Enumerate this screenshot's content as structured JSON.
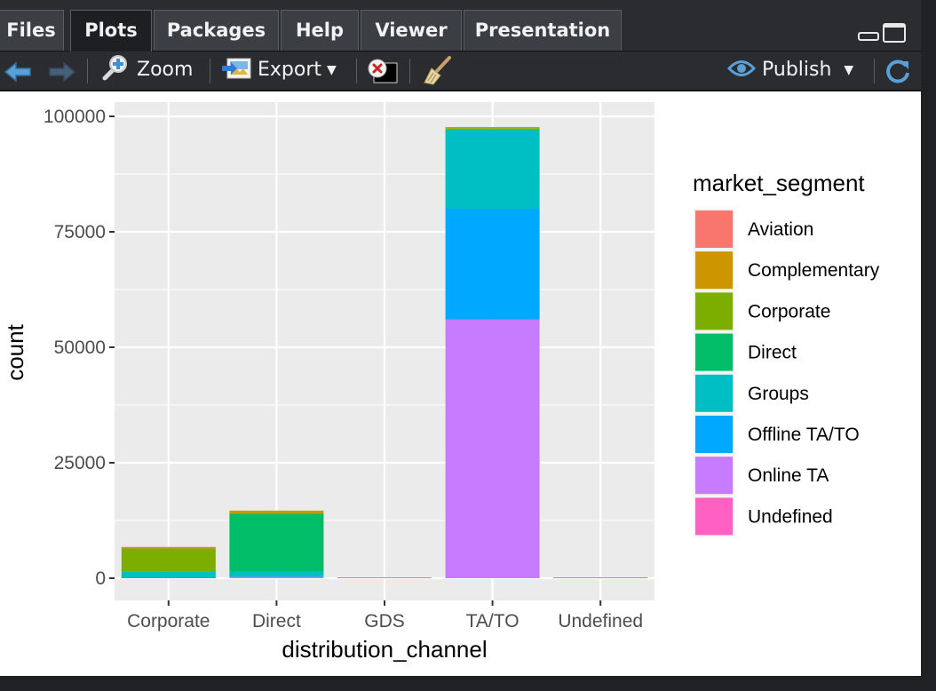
{
  "tabs": {
    "files": "Files",
    "plots": "Plots",
    "packages": "Packages",
    "help": "Help",
    "viewer": "Viewer",
    "presentation": "Presentation"
  },
  "toolbar": {
    "zoom_label": "Zoom",
    "export_label": "Export",
    "publish_label": "Publish"
  },
  "colors": {
    "panel_bg": "#ebebeb",
    "grid": "#ffffff"
  },
  "chart_data": {
    "type": "bar",
    "stacked": true,
    "xlabel": "distribution_channel",
    "ylabel": "count",
    "ylim": [
      0,
      103000
    ],
    "y_ticks": [
      0,
      25000,
      50000,
      75000,
      100000
    ],
    "y_tick_labels": [
      "0",
      "25000",
      "50000",
      "75000",
      "100000"
    ],
    "categories": [
      "Corporate",
      "Direct",
      "GDS",
      "TA/TO",
      "Undefined"
    ],
    "legend_title": "market_segment",
    "legend_position": "right",
    "series": [
      {
        "name": "Aviation",
        "color": "#F8766D",
        "values": [
          227,
          0,
          0,
          8,
          2
        ]
      },
      {
        "name": "Complementary",
        "color": "#CD9600",
        "values": [
          93,
          580,
          0,
          70,
          0
        ]
      },
      {
        "name": "Corporate",
        "color": "#7CAE00",
        "values": [
          4900,
          100,
          0,
          300,
          0
        ]
      },
      {
        "name": "Direct",
        "color": "#00BE67",
        "values": [
          50,
          12500,
          0,
          150,
          0
        ]
      },
      {
        "name": "Groups",
        "color": "#00BFC4",
        "values": [
          1400,
          1100,
          0,
          17000,
          0
        ]
      },
      {
        "name": "Offline TA/TO",
        "color": "#00A9FF",
        "values": [
          90,
          50,
          0,
          24000,
          1
        ]
      },
      {
        "name": "Online TA",
        "color": "#C77CFF",
        "values": [
          20,
          300,
          193,
          56000,
          1
        ]
      },
      {
        "name": "Undefined",
        "color": "#FF61C3",
        "values": [
          0,
          0,
          0,
          0,
          2
        ]
      }
    ]
  }
}
